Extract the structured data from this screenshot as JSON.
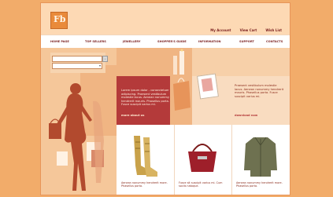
{
  "logo": {
    "text": "Fb"
  },
  "top_links": [
    "My Account",
    "View Cart",
    "Wish List"
  ],
  "nav": [
    "HOME PAGE",
    "TOP SELLERS",
    "JEWELLERY",
    "SHOPPER'S GUIDE",
    "INFORMATION",
    "SUPPORT",
    "CONTACTS"
  ],
  "search": {
    "input_value": "",
    "select_value": ""
  },
  "promo_left": {
    "text": "Lorem ipsum dolor - consectetuer adipiscing. Praesent vestibulum molestie lacus. Aenean nonummy hendrerit mauris. Phasellus porta. Fusce suscipit varius mi.",
    "link": "more about us"
  },
  "promo_right": {
    "text": "Praesent vestibulum molestie lacus. Aenean nonummy hendrerit mauris. Phasellus porta. Fusce suscipit varius mi.",
    "link": "download now"
  },
  "products": [
    {
      "desc": "Aenean nonummy hendrerit more. Phasellus porta."
    },
    {
      "desc": "Fusce sit suscipit varius mi. Cum sociis natoque."
    },
    {
      "desc": "Aenean nonummy hendrerit more. Phasellus porta."
    }
  ],
  "colors": {
    "background": "#f2ac6a",
    "accent": "#b43a3a",
    "header": "#fdd9b4"
  }
}
